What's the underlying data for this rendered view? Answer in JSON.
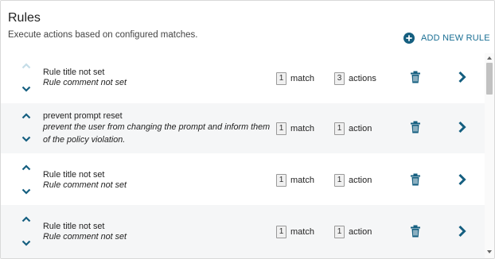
{
  "header": {
    "title": "Rules",
    "subtitle": "Execute actions based on configured matches.",
    "add_label": "ADD NEW RULE"
  },
  "colors": {
    "accent": "#155f80",
    "arrow_disabled": "#c5dde8",
    "row_alt_bg": "#f5f6f7"
  },
  "icons": {
    "up": "chevron-up-icon",
    "down": "chevron-down-icon",
    "delete": "trash-icon",
    "open": "chevron-right-icon",
    "add": "plus-circle-icon"
  },
  "rules": [
    {
      "title": "Rule title not set",
      "comment": "Rule comment not set",
      "match_count": "1",
      "match_label": "match",
      "action_count": "3",
      "action_label": "actions",
      "up_disabled": true
    },
    {
      "title": "prevent prompt reset",
      "comment": "prevent the user from changing the prompt and inform them of the policy violation.",
      "match_count": "1",
      "match_label": "match",
      "action_count": "1",
      "action_label": "action",
      "up_disabled": false
    },
    {
      "title": "Rule title not set",
      "comment": "Rule comment not set",
      "match_count": "1",
      "match_label": "match",
      "action_count": "1",
      "action_label": "action",
      "up_disabled": false
    },
    {
      "title": "Rule title not set",
      "comment": "Rule comment not set",
      "match_count": "1",
      "match_label": "match",
      "action_count": "1",
      "action_label": "action",
      "up_disabled": false
    }
  ]
}
